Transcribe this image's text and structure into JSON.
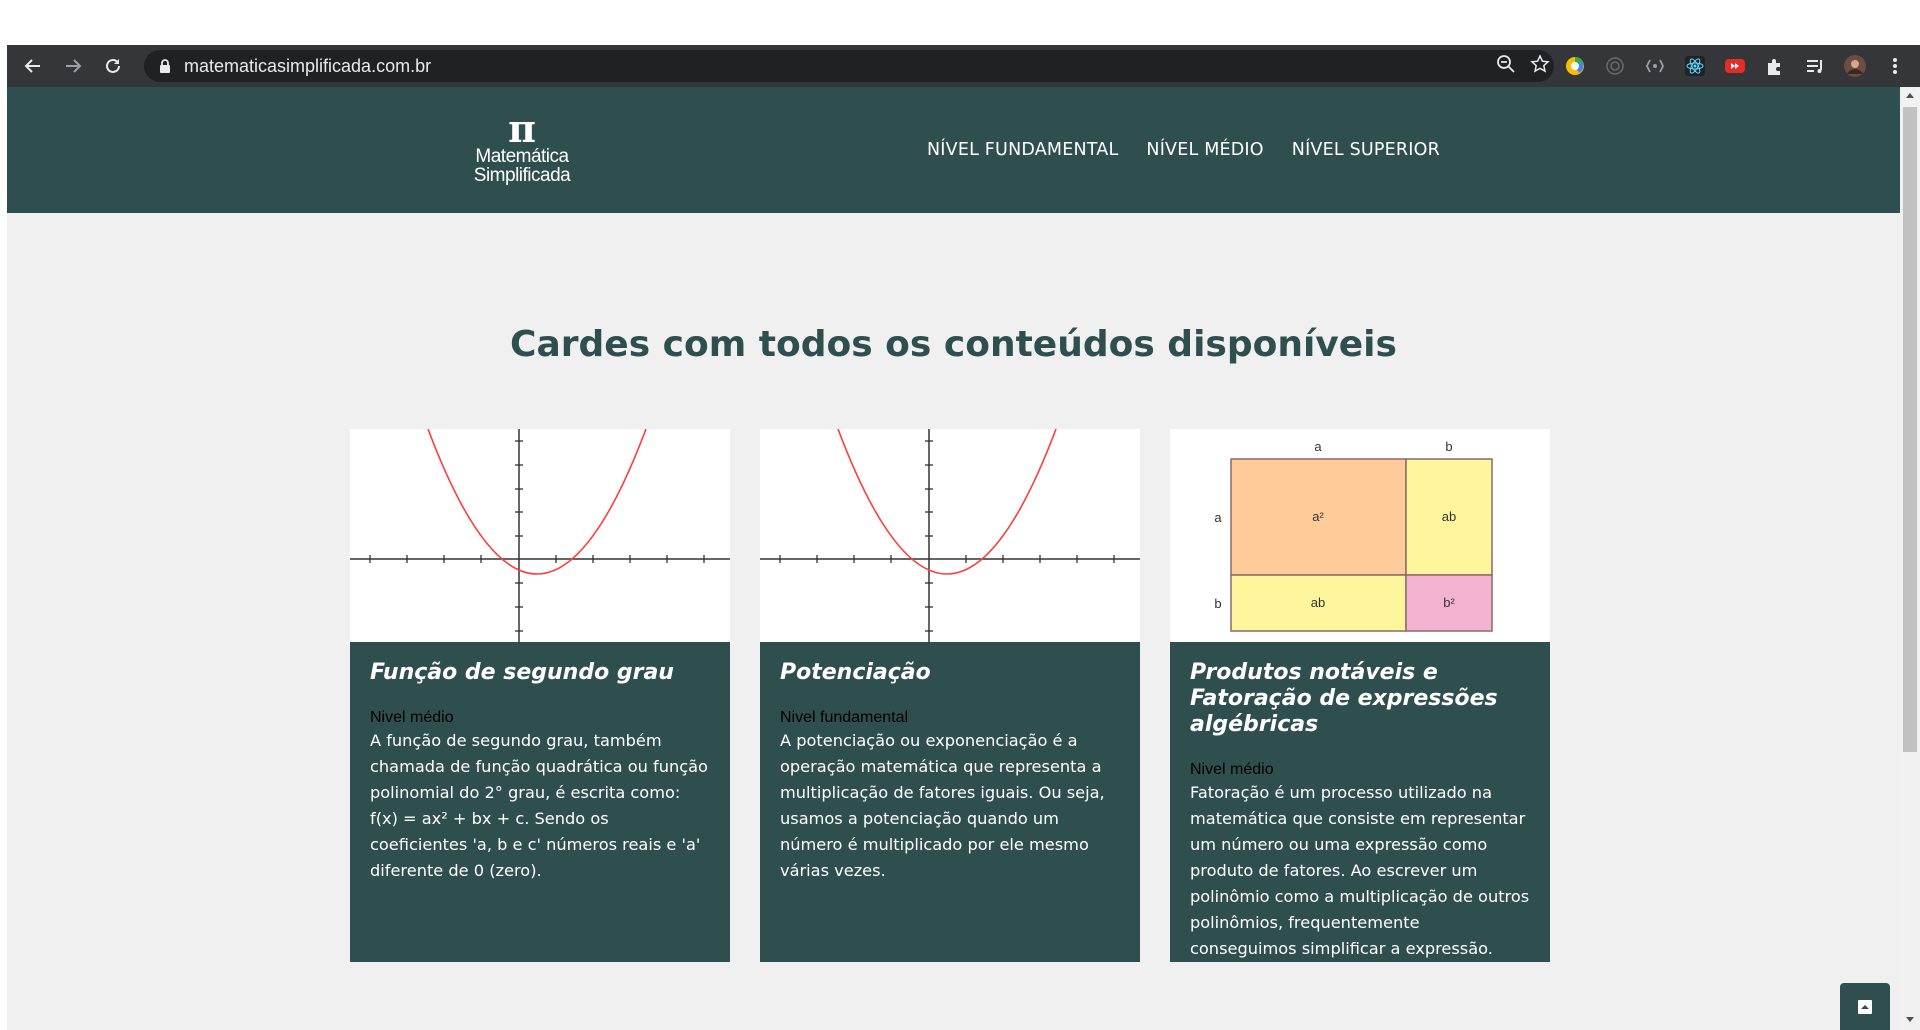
{
  "browser": {
    "url": "matematicasimplificada.com.br"
  },
  "header": {
    "logo_symbol": "π",
    "logo_line1": "Matemática",
    "logo_line2": "Simplificada",
    "nav": [
      {
        "label": "NÍVEL FUNDAMENTAL"
      },
      {
        "label": "NÍVEL MÉDIO"
      },
      {
        "label": "NÍVEL SUPERIOR"
      }
    ]
  },
  "main": {
    "title": "Cardes com todos os conteúdos disponíveis",
    "cards": [
      {
        "title": "Função de segundo grau",
        "level": "Nivel médio",
        "text": "A função de segundo grau, também chamada de função quadrática ou função polinomial do 2° grau, é escrita como: f(x) = ax² + bx + c. Sendo os coeficientes 'a, b e c' números reais e 'a' diferente de 0 (zero)."
      },
      {
        "title": "Potenciação",
        "level": "Nivel fundamental",
        "text": "A potenciação ou exponenciação é a operação matemática que representa a multiplicação de fatores iguais. Ou seja, usamos a potenciação quando um número é multiplicado por ele mesmo várias vezes."
      },
      {
        "title": "Produtos notáveis e Fatoração de expressões algébricas",
        "level": "Nivel médio",
        "text": "Fatoração é um processo utilizado na matemática que consiste em representar um número ou uma expressão como produto de fatores. Ao escrever um polinômio como a multiplicação de outros polinômios, frequentemente conseguimos simplificar a expressão.",
        "diagram": {
          "top_a": "a",
          "top_b": "b",
          "side_a": "a",
          "side_b": "b",
          "cell_a2": "a²",
          "cell_ab_top": "ab",
          "cell_ab_bottom": "ab",
          "cell_b2": "b²"
        }
      }
    ]
  },
  "colors": {
    "brand": "#2f4f4f",
    "curve": "#ff3b3b",
    "a2": "#ffcc99",
    "ab": "#fff59d",
    "b2": "#f4b3d0"
  }
}
